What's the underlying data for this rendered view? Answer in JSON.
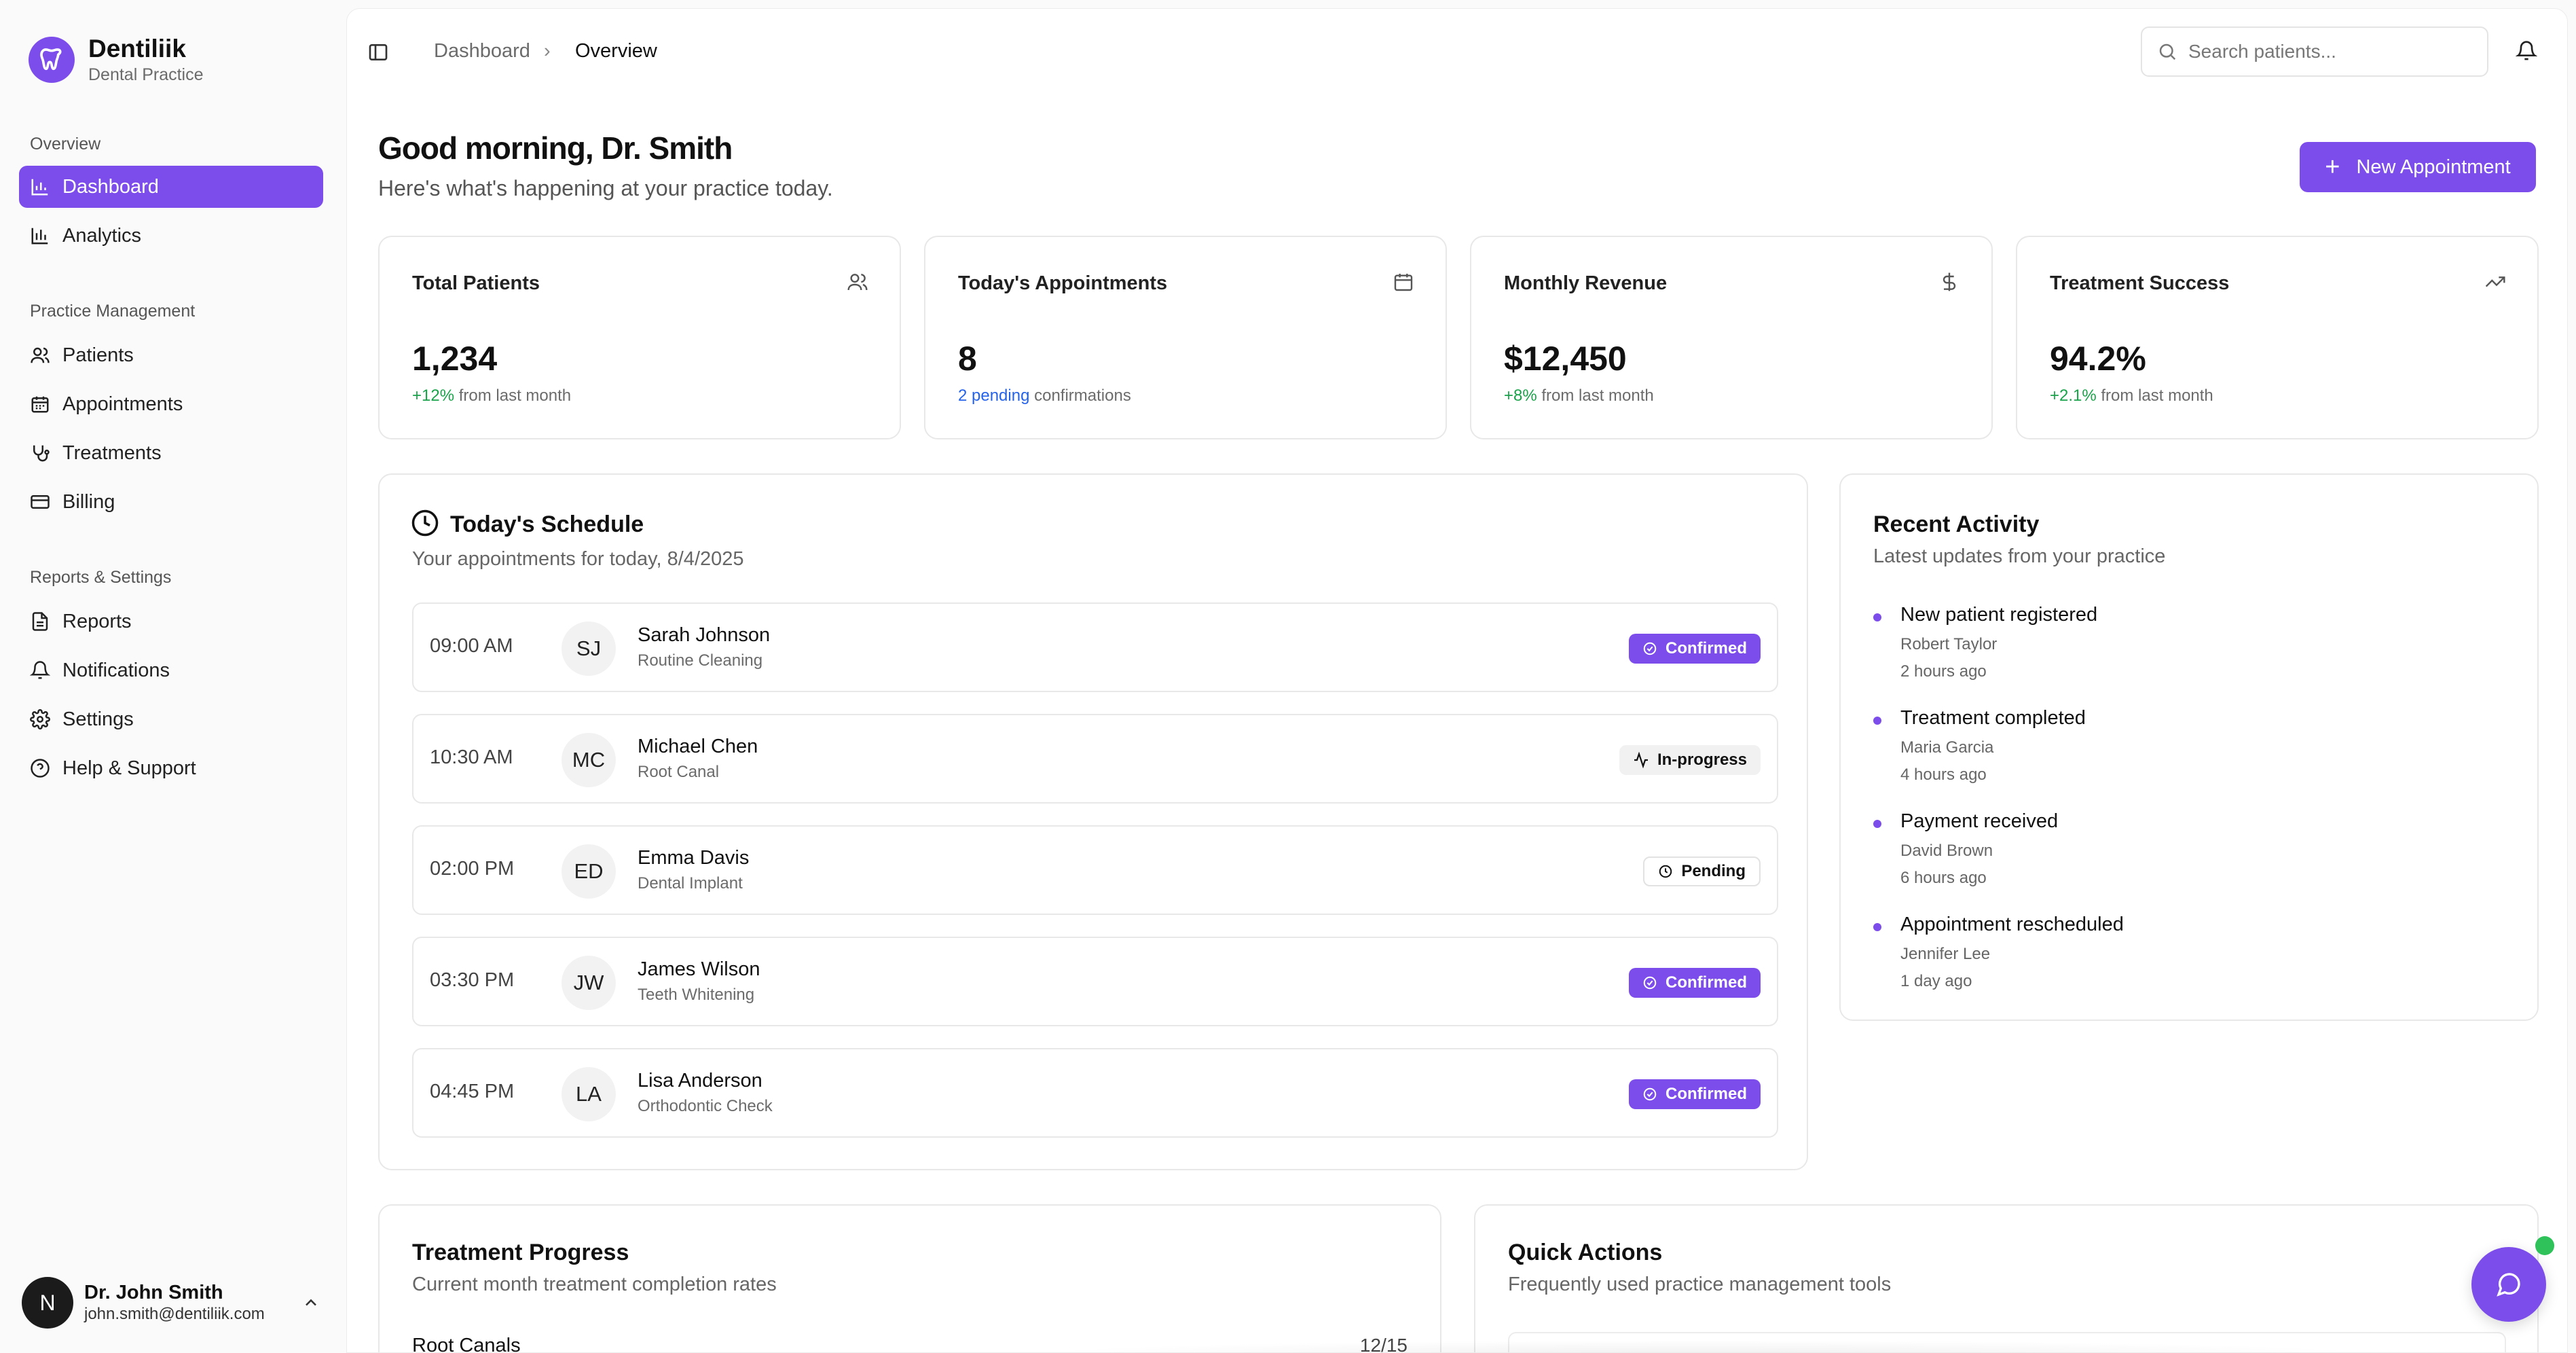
{
  "brand": {
    "name": "Dentiliik",
    "subtitle": "Dental Practice"
  },
  "sidebar": {
    "groups": [
      {
        "label": "Overview",
        "items": [
          {
            "label": "Dashboard",
            "icon": "bar-chart-icon",
            "active": true
          },
          {
            "label": "Analytics",
            "icon": "analytics-icon"
          }
        ]
      },
      {
        "label": "Practice Management",
        "items": [
          {
            "label": "Patients",
            "icon": "users-icon"
          },
          {
            "label": "Appointments",
            "icon": "calendar-icon"
          },
          {
            "label": "Treatments",
            "icon": "stethoscope-icon"
          },
          {
            "label": "Billing",
            "icon": "credit-card-icon"
          }
        ]
      },
      {
        "label": "Reports & Settings",
        "items": [
          {
            "label": "Reports",
            "icon": "file-text-icon"
          },
          {
            "label": "Notifications",
            "icon": "bell-icon"
          },
          {
            "label": "Settings",
            "icon": "gear-icon"
          },
          {
            "label": "Help & Support",
            "icon": "help-circle-icon"
          }
        ]
      }
    ],
    "user": {
      "initial": "N",
      "name": "Dr. John Smith",
      "email": "john.smith@dentiliik.com"
    }
  },
  "breadcrumb": {
    "root": "Dashboard",
    "separator": "›",
    "current": "Overview"
  },
  "search": {
    "placeholder": "Search patients..."
  },
  "header": {
    "greeting": "Good morning, Dr. Smith",
    "subtitle": "Here's what's happening at your practice today.",
    "new_appointment_label": "New Appointment"
  },
  "stats": [
    {
      "title": "Total Patients",
      "value": "1,234",
      "delta": "+12%",
      "delta_rest": " from last month",
      "icon": "users-icon"
    },
    {
      "title": "Today's Appointments",
      "value": "8",
      "delta": "2 pending",
      "delta_rest": " confirmations",
      "icon": "calendar-icon"
    },
    {
      "title": "Monthly Revenue",
      "value": "$12,450",
      "delta": "+8%",
      "delta_rest": " from last month",
      "icon": "dollar-icon"
    },
    {
      "title": "Treatment Success",
      "value": "94.2%",
      "delta": "+2.1%",
      "delta_rest": " from last month",
      "icon": "trending-up-icon"
    }
  ],
  "schedule": {
    "title": "Today's Schedule",
    "subtitle": "Your appointments for today, 8/4/2025",
    "appointments": [
      {
        "time": "09:00 AM",
        "initials": "SJ",
        "name": "Sarah Johnson",
        "type": "Routine Cleaning",
        "status": "Confirmed"
      },
      {
        "time": "10:30 AM",
        "initials": "MC",
        "name": "Michael Chen",
        "type": "Root Canal",
        "status": "In-progress"
      },
      {
        "time": "02:00 PM",
        "initials": "ED",
        "name": "Emma Davis",
        "type": "Dental Implant",
        "status": "Pending"
      },
      {
        "time": "03:30 PM",
        "initials": "JW",
        "name": "James Wilson",
        "type": "Teeth Whitening",
        "status": "Confirmed"
      },
      {
        "time": "04:45 PM",
        "initials": "LA",
        "name": "Lisa Anderson",
        "type": "Orthodontic Check",
        "status": "Confirmed"
      }
    ]
  },
  "activity": {
    "title": "Recent Activity",
    "subtitle": "Latest updates from your practice",
    "items": [
      {
        "title": "New patient registered",
        "name": "Robert Taylor",
        "time": "2 hours ago"
      },
      {
        "title": "Treatment completed",
        "name": "Maria Garcia",
        "time": "4 hours ago"
      },
      {
        "title": "Payment received",
        "name": "David Brown",
        "time": "6 hours ago"
      },
      {
        "title": "Appointment rescheduled",
        "name": "Jennifer Lee",
        "time": "1 day ago"
      }
    ]
  },
  "treatment_progress": {
    "title": "Treatment Progress",
    "subtitle": "Current month treatment completion rates",
    "rows": [
      {
        "label": "Root Canals",
        "count": "12/15"
      }
    ]
  },
  "quick_actions": {
    "title": "Quick Actions",
    "subtitle": "Frequently used practice management tools"
  },
  "colors": {
    "accent": "#7c4dea",
    "positive": "#1aa34a",
    "link": "#2563eb",
    "online": "#2fc25b"
  }
}
